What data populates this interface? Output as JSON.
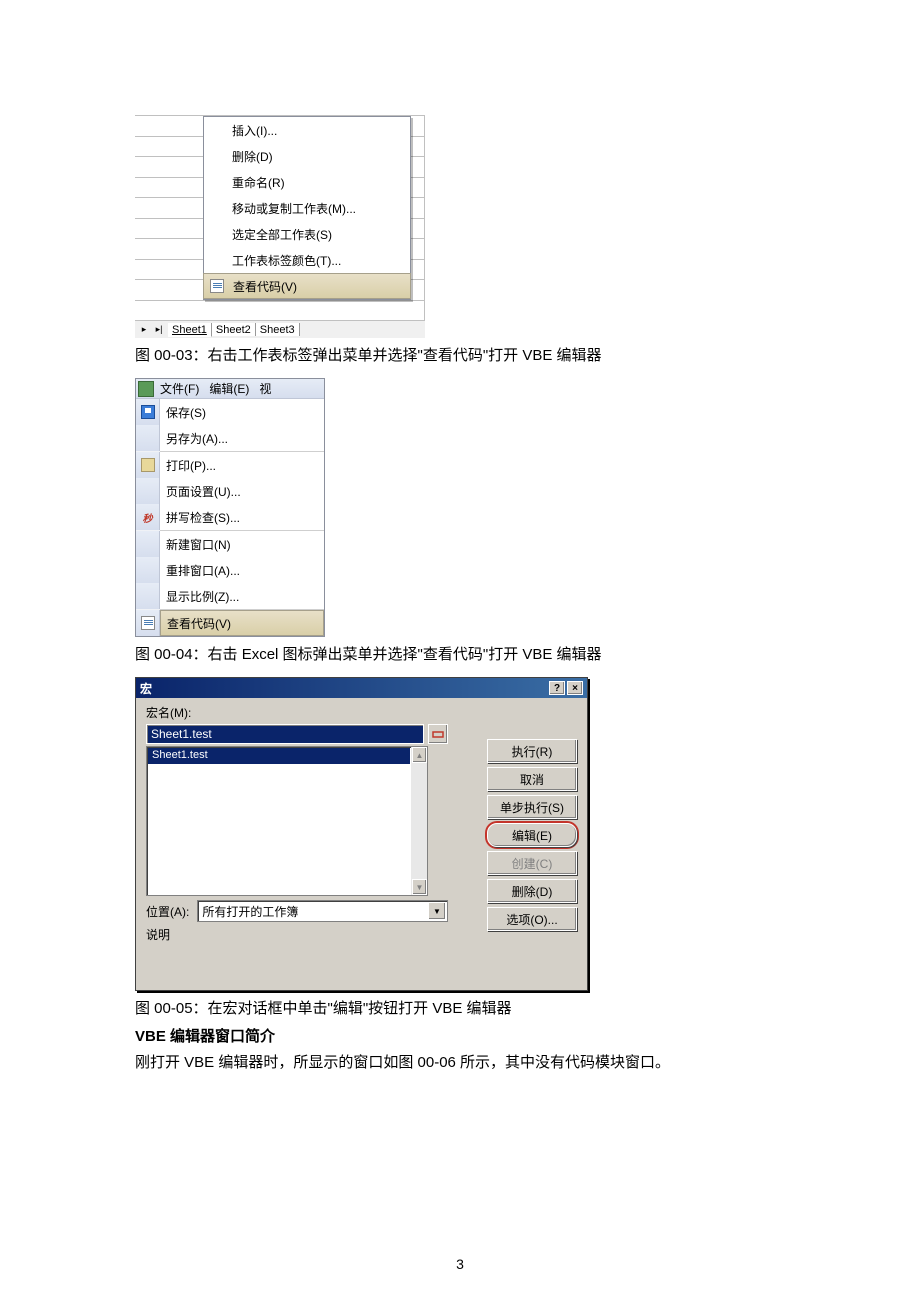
{
  "figure1": {
    "menu_items": [
      {
        "label": "插入(I)..."
      },
      {
        "label": "删除(D)"
      },
      {
        "label": "重命名(R)"
      },
      {
        "label": "移动或复制工作表(M)..."
      },
      {
        "label": "选定全部工作表(S)"
      },
      {
        "label": "工作表标签颜色(T)..."
      },
      {
        "label": "查看代码(V)",
        "selected": true,
        "icon": "code"
      }
    ],
    "tabs": [
      "Sheet1",
      "Sheet2",
      "Sheet3"
    ]
  },
  "caption1": "图 00-03：右击工作表标签弹出菜单并选择\"查看代码\"打开 VBE 编辑器",
  "figure2": {
    "menubar": {
      "file": "文件(F)",
      "edit": "编辑(E)",
      "view": "视"
    },
    "items": [
      {
        "label": "保存(S)",
        "icon": "save"
      },
      {
        "label": "另存为(A)..."
      },
      {
        "label": "打印(P)...",
        "icon": "print",
        "divider_before": true
      },
      {
        "label": "页面设置(U)..."
      },
      {
        "label": "拼写检查(S)...",
        "icon": "spell"
      },
      {
        "label": "新建窗口(N)",
        "divider_before": true
      },
      {
        "label": "重排窗口(A)..."
      },
      {
        "label": "显示比例(Z)..."
      },
      {
        "label": "查看代码(V)",
        "icon": "code",
        "divider_before": true,
        "selected": true
      }
    ]
  },
  "caption2": "图 00-04：右击 Excel 图标弹出菜单并选择\"查看代码\"打开 VBE 编辑器",
  "macro_dialog": {
    "title": "宏",
    "macro_name_label": "宏名(M):",
    "macro_name_value": "Sheet1.test",
    "list_item": "Sheet1.test",
    "location_label": "位置(A):",
    "location_value": "所有打开的工作簿",
    "description_label": "说明",
    "buttons": {
      "run": "执行(R)",
      "cancel": "取消",
      "step": "单步执行(S)",
      "edit": "编辑(E)",
      "create": "创建(C)",
      "delete": "删除(D)",
      "options": "选项(O)..."
    }
  },
  "caption3": "图 00-05：在宏对话框中单击\"编辑\"按钮打开 VBE 编辑器",
  "heading": "VBE 编辑器窗口简介",
  "body_text": "刚打开 VBE 编辑器时，所显示的窗口如图 00-06 所示，其中没有代码模块窗口。",
  "page_number": "3"
}
